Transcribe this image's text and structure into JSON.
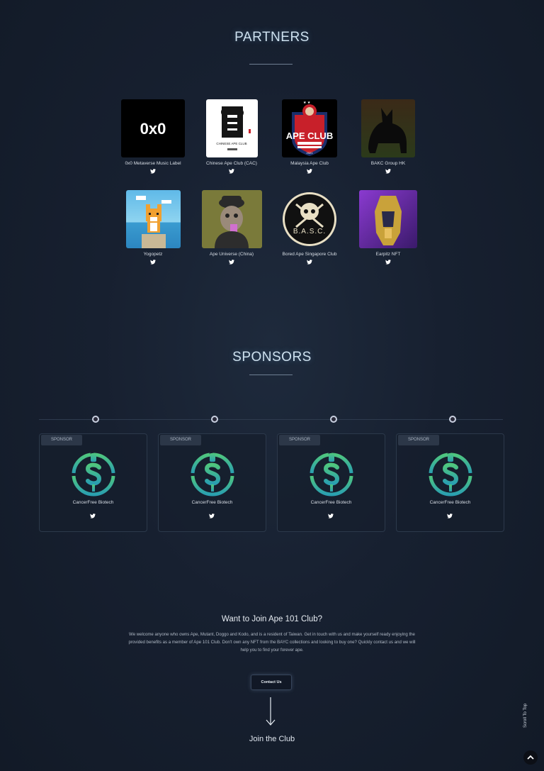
{
  "partners": {
    "title": "PARTNERS",
    "items": [
      {
        "name": "0x0 Metaverse Music Label",
        "logo_text": "0x0"
      },
      {
        "name": "Chinese Ape Club (CAC)",
        "logo_text": "CHINESE APE CLUB"
      },
      {
        "name": "Malaysia Ape Club",
        "logo_text": "APE CLUB",
        "logo_year": "2021"
      },
      {
        "name": "BAKC Group HK"
      },
      {
        "name": "Yogopetz"
      },
      {
        "name": "Ape Universe (China)"
      },
      {
        "name": "Bored Ape Singapore Club",
        "logo_text": "B.A.S.C."
      },
      {
        "name": "Earpitz NFT"
      }
    ]
  },
  "sponsors": {
    "title": "SPONSORS",
    "items": [
      {
        "badge": "SPONSOR",
        "name": "CancerFree Biotech"
      },
      {
        "badge": "SPONSOR",
        "name": "CancerFree Biotech"
      },
      {
        "badge": "SPONSOR",
        "name": "CancerFree Biotech"
      },
      {
        "badge": "SPONSOR",
        "name": "CancerFree Biotech"
      }
    ]
  },
  "join": {
    "title": "Want to Join Ape 101 Club?",
    "text": "We welcome anyone who owns Ape, Mutant, Doggo and Kodo, and is a resident of Taiwan. Get in touch with us and make yourself ready enjoying the provided benefits as a member of Ape 101 Club. Don't own any NFT from the BAYC collections and looking to buy one? Quickly contact us and we will help you to find your forever ape.",
    "button": "Contact Us",
    "link": "Join the Club"
  },
  "scroll_to_top": "Scroll To Top",
  "icons": {
    "twitter": "twitter-icon",
    "scroll": "chevron-up-icon",
    "arrow": "arrow-down-icon"
  },
  "colors": {
    "accent": "#3fb79b",
    "background": "#172030"
  }
}
